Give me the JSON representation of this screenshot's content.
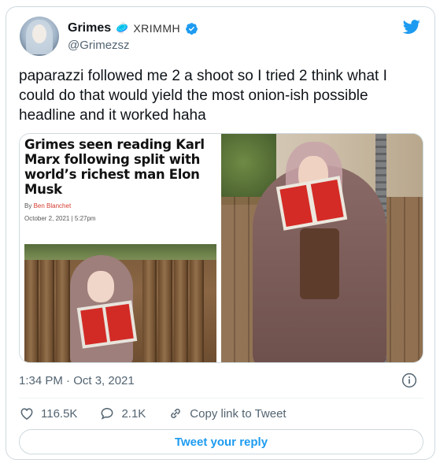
{
  "author": {
    "display_name": "Grimes",
    "name_emoji": "🥏",
    "name_suffix": "XRIMMH",
    "handle": "@Grimezsz",
    "verified": true
  },
  "tweet": {
    "text": "paparazzi followed me 2 a shoot so I tried 2 think what I could do that would yield the most onion-ish possible headline and it worked haha",
    "timestamp": "1:34 PM · Oct 3, 2021"
  },
  "media": {
    "article_headline": "Grimes seen reading Karl Marx following split with world’s richest man Elon Musk",
    "byline_prefix": "By",
    "byline_name": "Ben Blanchet",
    "article_date": "October 2, 2021 | 5:27pm"
  },
  "actions": {
    "likes": "116.5K",
    "replies": "2.1K",
    "copy_link_label": "Copy link to Tweet",
    "reply_button_label": "Tweet your reply"
  },
  "colors": {
    "accent": "#1d9bf0",
    "secondary_text": "#536471",
    "border": "#cfd9de"
  },
  "icons": {
    "logo": "twitter-bird-icon",
    "verified": "verified-badge-icon",
    "info": "info-icon",
    "like": "heart-icon",
    "reply": "reply-bubble-icon",
    "copy_link": "link-icon"
  }
}
